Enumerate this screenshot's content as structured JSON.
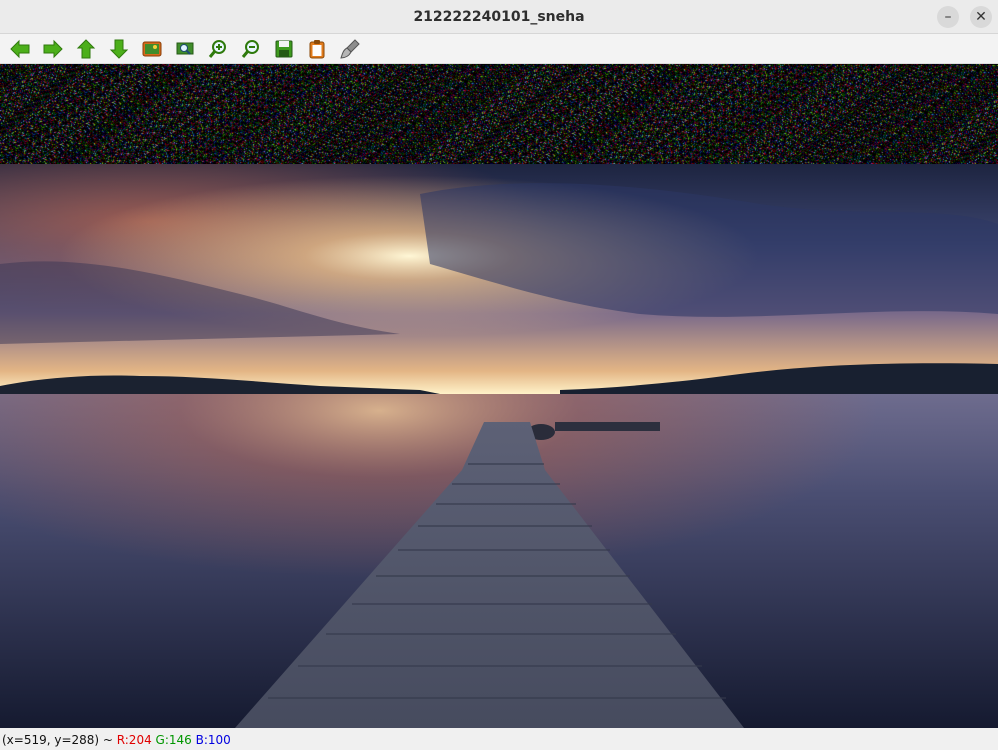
{
  "window": {
    "title": "212222240101_sneha",
    "minimize_glyph": "–",
    "close_glyph": "✕"
  },
  "toolbar": {
    "buttons": [
      {
        "icon": "arrow-left-icon"
      },
      {
        "icon": "arrow-right-icon"
      },
      {
        "icon": "arrow-up-icon"
      },
      {
        "icon": "arrow-down-icon"
      },
      {
        "icon": "image-icon"
      },
      {
        "icon": "zoom-fit-icon"
      },
      {
        "icon": "zoom-in-icon"
      },
      {
        "icon": "zoom-out-icon"
      },
      {
        "icon": "save-icon"
      },
      {
        "icon": "clipboard-icon"
      },
      {
        "icon": "properties-brush-icon"
      }
    ]
  },
  "status": {
    "coords": "(x=519, y=288) ~ ",
    "r": "R:204",
    "g": "G:146",
    "b": "B:100"
  }
}
